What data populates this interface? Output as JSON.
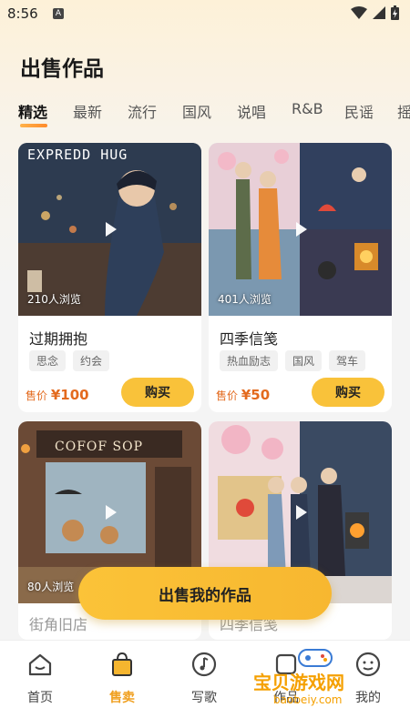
{
  "status": {
    "time": "8:56",
    "a_icon": "A"
  },
  "page": {
    "title": "出售作品"
  },
  "tabs": [
    "精选",
    "最新",
    "流行",
    "国风",
    "说唱",
    "R&B",
    "民谣",
    "摇"
  ],
  "cards": [
    {
      "title": "过期拥抱",
      "views": "210人浏览",
      "tags": [
        "思念",
        "约会"
      ],
      "price_label": "售价",
      "price": "¥100",
      "buy": "购买",
      "image_text": "EXPREDD HUG"
    },
    {
      "title": "四季信笺",
      "views": "401人浏览",
      "tags": [
        "热血励志",
        "国风",
        "驾车"
      ],
      "price_label": "售价",
      "price": "¥50",
      "buy": "购买"
    },
    {
      "title": "街角旧店",
      "views": "80人浏览",
      "image_text": "COFOF SOP"
    },
    {
      "title": "四季信笺"
    }
  ],
  "sell_button": "出售我的作品",
  "nav": [
    {
      "label": "首页",
      "icon": "home-icon"
    },
    {
      "label": "售卖",
      "icon": "bag-icon",
      "active": true
    },
    {
      "label": "写歌",
      "icon": "music-icon"
    },
    {
      "label": "作品",
      "icon": "works-icon"
    },
    {
      "label": "我的",
      "icon": "profile-icon"
    }
  ],
  "watermark": {
    "text": "宝贝游戏网",
    "url": "baobeiy.com"
  },
  "colors": {
    "accent": "#f9c23a",
    "price": "#e36a1e",
    "active_nav": "#f0a020"
  }
}
